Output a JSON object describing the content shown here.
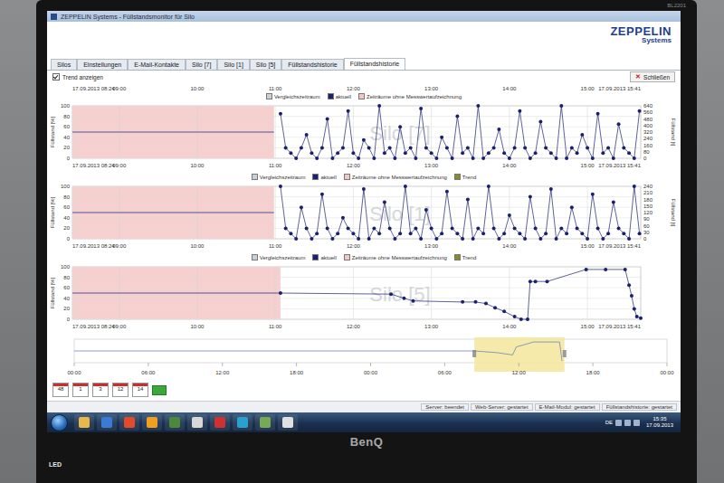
{
  "monitor": {
    "model": "BL2201",
    "brand": "BenQ",
    "badge": "LED"
  },
  "window": {
    "title": "ZEPPELIN Systems - Füllstandsmonitor für Silo"
  },
  "logo": {
    "name": "ZEPPELIN",
    "sub": "Systems"
  },
  "tabs": [
    {
      "label": "Silos",
      "selected": false
    },
    {
      "label": "Einstellungen",
      "selected": false
    },
    {
      "label": "E-Mail-Kontakte",
      "selected": false
    },
    {
      "label": "Silo [7]",
      "selected": false
    },
    {
      "label": "Silo [1]",
      "selected": false
    },
    {
      "label": "Silo [5]",
      "selected": false
    },
    {
      "label": "Füllstandshistorie",
      "selected": false
    },
    {
      "label": "Füllstandshistorie",
      "selected": true
    }
  ],
  "close_button": {
    "icon": "✕",
    "label": "Schließen"
  },
  "trend_checkbox": {
    "label": "Trend anzeigen",
    "checked": true
  },
  "time_axis": {
    "span_min": 437,
    "ticks": [
      {
        "label": "17.09.2013 08:24",
        "min": 0
      },
      {
        "label": "09:00",
        "min": 36
      },
      {
        "label": "10:00",
        "min": 96
      },
      {
        "label": "11:00",
        "min": 156
      },
      {
        "label": "12:00",
        "min": 216
      },
      {
        "label": "13:00",
        "min": 276
      },
      {
        "label": "14:00",
        "min": 336
      },
      {
        "label": "15:00",
        "min": 396
      },
      {
        "label": "17.09.2013 15:41",
        "min": 437
      }
    ]
  },
  "charts": [
    {
      "title": "Silo [7]",
      "y_title": "Füllstand [%]",
      "y2_title": "Füllstand [t]",
      "left_ticks": [
        "0",
        "20",
        "40",
        "60",
        "80",
        "100"
      ],
      "right_ticks": [
        "0",
        "80",
        "160",
        "240",
        "320",
        "400",
        "480",
        "560",
        "640"
      ],
      "legend": [
        {
          "label": "Vergleichszeitraum",
          "color": "#c8d0d8"
        },
        {
          "label": "aktuell",
          "color": "#1a1f6e"
        },
        {
          "label": "Zeiträume ohne Messwertaufzeichnung",
          "color": "#f4c6c6"
        }
      ],
      "gap": {
        "from_min": 0,
        "to_min": 155,
        "level": 50
      },
      "series": {
        "kind": "spikes",
        "start_min": 160,
        "step_min": 4,
        "values": [
          85,
          20,
          10,
          0,
          20,
          45,
          10,
          0,
          20,
          75,
          0,
          10,
          20,
          90,
          10,
          0,
          35,
          20,
          0,
          100,
          10,
          20,
          0,
          60,
          10,
          20,
          0,
          95,
          20,
          10,
          0,
          40,
          20,
          0,
          80,
          10,
          20,
          0,
          100,
          0,
          10,
          20,
          55,
          10,
          0,
          20,
          90,
          20,
          0,
          10,
          70,
          20,
          10,
          0,
          100,
          0,
          20,
          10,
          45,
          20,
          0,
          85,
          10,
          20,
          0,
          65,
          20,
          10,
          0,
          90
        ],
        "points": []
      }
    },
    {
      "title": "Silo [1]",
      "y_title": "Füllstand [%]",
      "y2_title": "Füllstand [t]",
      "left_ticks": [
        "0",
        "20",
        "40",
        "60",
        "80",
        "100"
      ],
      "right_ticks": [
        "0",
        "30",
        "60",
        "90",
        "120",
        "150",
        "180",
        "210",
        "240"
      ],
      "legend": [
        {
          "label": "Vergleichszeitraum",
          "color": "#c8d0d8"
        },
        {
          "label": "aktuell",
          "color": "#1a1f6e"
        },
        {
          "label": "Zeiträume ohne Messwertaufzeichnung",
          "color": "#f4c6c6"
        },
        {
          "label": "Trend",
          "color": "#8a8a2a"
        }
      ],
      "gap": {
        "from_min": 0,
        "to_min": 155,
        "level": 50
      },
      "series": {
        "kind": "spikes",
        "start_min": 160,
        "step_min": 4,
        "values": [
          100,
          20,
          10,
          0,
          60,
          20,
          0,
          10,
          85,
          20,
          0,
          10,
          40,
          20,
          10,
          0,
          95,
          0,
          20,
          10,
          70,
          20,
          0,
          10,
          100,
          10,
          20,
          0,
          55,
          20,
          0,
          10,
          90,
          20,
          10,
          0,
          75,
          0,
          20,
          10,
          100,
          20,
          0,
          10,
          45,
          20,
          10,
          0,
          80,
          20,
          0,
          10,
          95,
          0,
          20,
          10,
          60,
          20,
          10,
          0,
          85,
          20,
          0,
          10,
          70,
          20,
          10,
          0,
          100,
          10
        ],
        "points": []
      }
    },
    {
      "title": "Silo [5]",
      "y_title": "Füllstand [%]",
      "y2_title": "",
      "left_ticks": [
        "0",
        "20",
        "40",
        "60",
        "80",
        "100"
      ],
      "right_ticks": [],
      "legend": [
        {
          "label": "Vergleichszeitraum",
          "color": "#c8d0d8"
        },
        {
          "label": "aktuell",
          "color": "#1a1f6e"
        },
        {
          "label": "Zeiträume ohne Messwertaufzeichnung",
          "color": "#f4c6c6"
        },
        {
          "label": "Trend",
          "color": "#8a8a2a"
        }
      ],
      "gap": {
        "from_min": 0,
        "to_min": 160,
        "level": 50
      },
      "series": {
        "kind": "steps",
        "start_min": 0,
        "step_min": 0,
        "values": [],
        "points": [
          [
            160,
            50
          ],
          [
            245,
            48
          ],
          [
            255,
            40
          ],
          [
            262,
            35
          ],
          [
            300,
            33
          ],
          [
            310,
            33
          ],
          [
            318,
            30
          ],
          [
            325,
            22
          ],
          [
            332,
            15
          ],
          [
            340,
            5
          ],
          [
            345,
            0
          ],
          [
            350,
            0
          ],
          [
            352,
            72
          ],
          [
            356,
            72
          ],
          [
            365,
            72
          ],
          [
            395,
            95
          ],
          [
            410,
            95
          ],
          [
            425,
            95
          ],
          [
            428,
            65
          ],
          [
            430,
            45
          ],
          [
            432,
            20
          ],
          [
            434,
            5
          ],
          [
            437,
            2
          ]
        ]
      }
    }
  ],
  "overview": {
    "span_h": 48,
    "ticks": [
      "00:00",
      "06:00",
      "12:00",
      "18:00",
      "00:00",
      "06:00",
      "12:00",
      "18:00",
      "00:00"
    ],
    "selection": {
      "from_h": 32.4,
      "to_h": 39.7
    },
    "trace": [
      [
        0,
        50
      ],
      [
        32.4,
        50
      ],
      [
        34.2,
        42
      ],
      [
        35.5,
        30
      ],
      [
        35.8,
        70
      ],
      [
        37.2,
        95
      ],
      [
        39.3,
        95
      ],
      [
        39.5,
        0
      ]
    ]
  },
  "range_buttons": [
    {
      "label": "48"
    },
    {
      "label": "1"
    },
    {
      "label": "3"
    },
    {
      "label": "12"
    },
    {
      "label": "14"
    }
  ],
  "status_bar": [
    "Server: beendet",
    "Web-Server: gestartet",
    "E-Mail-Modul: gestartet",
    "Füllstandshistorie: gestartet"
  ],
  "taskbar": {
    "apps": [
      {
        "color": "#e8b84a"
      },
      {
        "color": "#3a7bd5"
      },
      {
        "color": "#e24a2a"
      },
      {
        "color": "#f0a020"
      },
      {
        "color": "#4a8a3a"
      },
      {
        "color": "#d8d8d8"
      },
      {
        "color": "#d03030"
      },
      {
        "color": "#2aa0d0"
      },
      {
        "color": "#77aa55"
      },
      {
        "color": "#e0e0e0"
      }
    ],
    "language": "DE",
    "time": "15:35",
    "date": "17.09.2013"
  }
}
